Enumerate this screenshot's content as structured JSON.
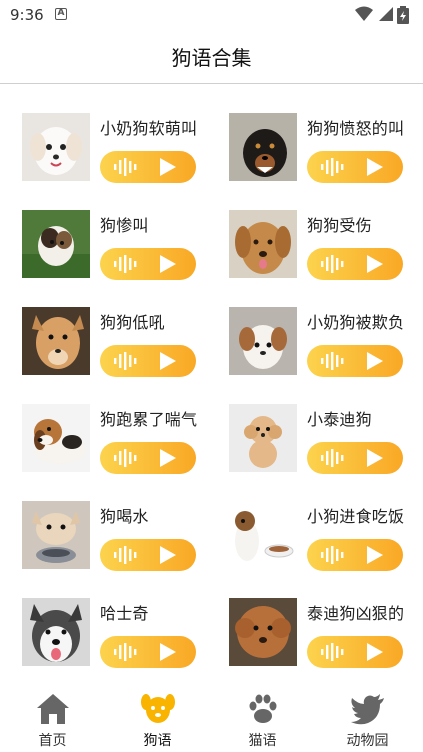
{
  "status": {
    "time": "9:36",
    "a_icon": "A"
  },
  "header": {
    "title": "狗语合集"
  },
  "items": [
    {
      "name": "小奶狗软萌叫",
      "photo": "white-puppy-photo"
    },
    {
      "name": "狗狗愤怒的叫",
      "photo": "angry-rottweiler-photo"
    },
    {
      "name": "狗惨叫",
      "photo": "puppy-on-grass-photo"
    },
    {
      "name": "狗狗受伤",
      "photo": "golden-dog-photo"
    },
    {
      "name": "狗狗低吼",
      "photo": "growling-dog-photo"
    },
    {
      "name": "小奶狗被欺负",
      "photo": "small-puppy-photo"
    },
    {
      "name": "狗跑累了喘气",
      "photo": "beagle-photo"
    },
    {
      "name": "小泰迪狗",
      "photo": "teddy-poodle-photo"
    },
    {
      "name": "狗喝水",
      "photo": "bulldog-drinking-photo"
    },
    {
      "name": "小狗进食吃饭",
      "photo": "terrier-eating-photo"
    },
    {
      "name": "哈士奇",
      "photo": "husky-photo"
    },
    {
      "name": "泰迪狗凶狠的",
      "photo": "fierce-poodle-photo"
    }
  ],
  "tabs": [
    {
      "label": "首页",
      "icon": "home-icon",
      "active": false
    },
    {
      "label": "狗语",
      "icon": "dog-face-icon",
      "active": true
    },
    {
      "label": "猫语",
      "icon": "paw-icon",
      "active": false
    },
    {
      "label": "动物园",
      "icon": "bird-icon",
      "active": false
    }
  ],
  "colors": {
    "accent_start": "#fcd34d",
    "accent_end": "#f9a825",
    "active_tab": "#f8b400",
    "inactive_tab": "#666666"
  }
}
